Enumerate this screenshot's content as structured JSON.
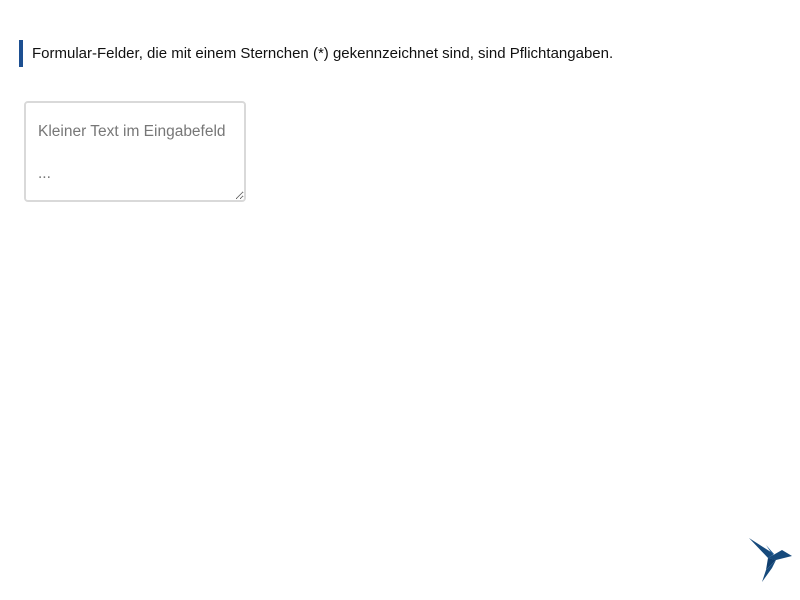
{
  "notice": {
    "text": "Formular-Felder, die mit einem Sternchen (*) gekennzeichnet sind, sind Pflichtangaben."
  },
  "field": {
    "value": "",
    "placeholder": "Kleiner Text im Eingabefeld\n\n..."
  },
  "logo": {
    "icon": "hummingbird-logo-icon",
    "color": "#164a7c"
  }
}
